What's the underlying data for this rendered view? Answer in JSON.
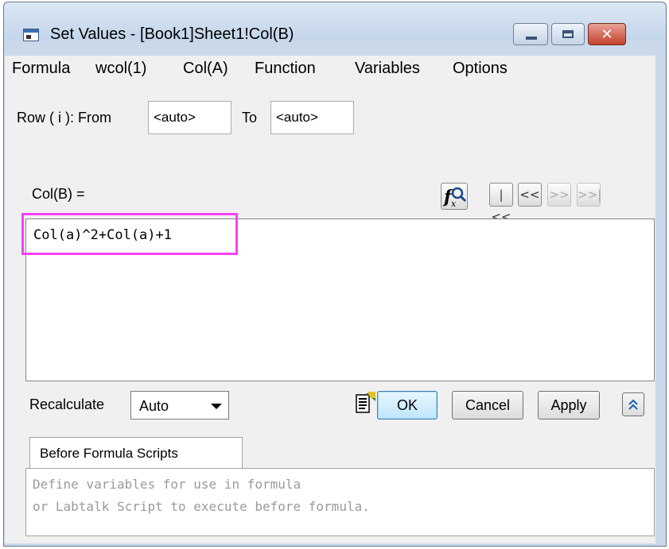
{
  "window": {
    "title": "Set Values - [Book1]Sheet1!Col(B)",
    "icons": {
      "app": "worksheet-icon",
      "minimize": "minimize-icon",
      "maximize": "maximize-icon",
      "close": "close-icon"
    },
    "close_glyph": "✕"
  },
  "menu": [
    "Formula",
    "wcol(1)",
    "Col(A)",
    "Function",
    "Variables",
    "Options"
  ],
  "row_range": {
    "label": "Row ( i ):  From",
    "from_value": "<auto>",
    "to_label": "To",
    "to_value": "<auto>"
  },
  "formula": {
    "label": "Col(B) =",
    "text": "Col(a)^2+Col(a)+1",
    "highlight_color": "#f542f5"
  },
  "toolbar": {
    "function_builder_icon": "function-search-icon",
    "first": "|<<",
    "prev": "<<",
    "next": ">>",
    "last": ">>|"
  },
  "recalculate": {
    "label": "Recalculate",
    "value": "Auto"
  },
  "buttons": {
    "script_icon": "script-page-icon",
    "ok": "OK",
    "cancel": "Cancel",
    "apply": "Apply",
    "expand_icon": "double-chevron-up-icon",
    "expand_glyph": "⌃"
  },
  "before_scripts": {
    "tab_label": "Before Formula Scripts",
    "placeholder_line1": "Define variables for use in formula",
    "placeholder_line2": "or Labtalk Script to execute before formula."
  },
  "colors": {
    "accent": "#3c7fb1",
    "highlight": "#f542f5"
  }
}
